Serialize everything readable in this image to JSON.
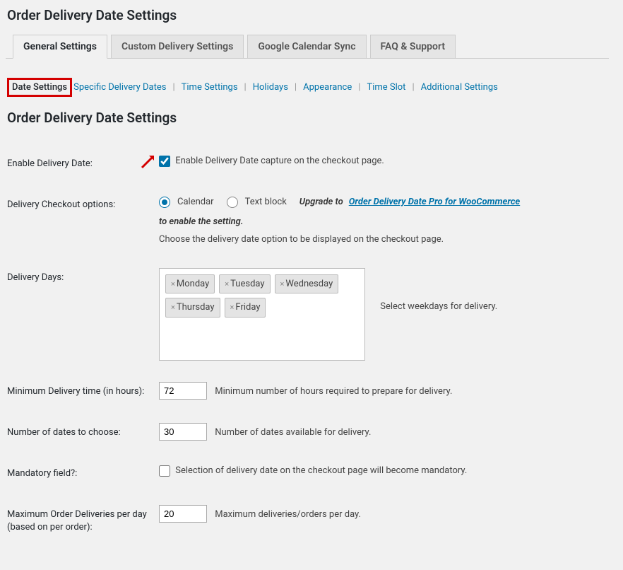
{
  "page_title": "Order Delivery Date Settings",
  "tabs": {
    "general": "General Settings",
    "custom": "Custom Delivery Settings",
    "gcal": "Google Calendar Sync",
    "faq": "FAQ & Support"
  },
  "subtabs": {
    "date_settings": "Date Settings",
    "specific_dates": "Specific Delivery Dates",
    "time_settings": "Time Settings",
    "holidays": "Holidays",
    "appearance": "Appearance",
    "time_slot": "Time Slot",
    "additional": "Additional Settings"
  },
  "section_heading": "Order Delivery Date Settings",
  "fields": {
    "enable_delivery": {
      "label": "Enable Delivery Date:",
      "checkbox_checked": true,
      "description": "Enable Delivery Date capture on the checkout page."
    },
    "checkout_options": {
      "label": "Delivery Checkout options:",
      "radio_calendar": "Calendar",
      "radio_textblock": "Text block",
      "upgrade_prefix": "Upgrade to ",
      "upgrade_link": "Order Delivery Date Pro for WooCommerce ",
      "upgrade_suffix": "to enable the setting.",
      "description": "Choose the delivery date option to be displayed on the checkout page."
    },
    "delivery_days": {
      "label": "Delivery Days:",
      "days": [
        "Monday",
        "Tuesday",
        "Wednesday",
        "Thursday",
        "Friday"
      ],
      "help": "Select weekdays for delivery."
    },
    "min_time": {
      "label": "Minimum Delivery time (in hours):",
      "value": "72",
      "help": "Minimum number of hours required to prepare for delivery."
    },
    "num_dates": {
      "label": "Number of dates to choose:",
      "value": "30",
      "help": "Number of dates available for delivery."
    },
    "mandatory": {
      "label": "Mandatory field?:",
      "checked": false,
      "help": "Selection of delivery date on the checkout page will become mandatory."
    },
    "max_orders": {
      "label": "Maximum Order Deliveries per day (based on per order):",
      "value": "20",
      "help": "Maximum deliveries/orders per day."
    }
  }
}
